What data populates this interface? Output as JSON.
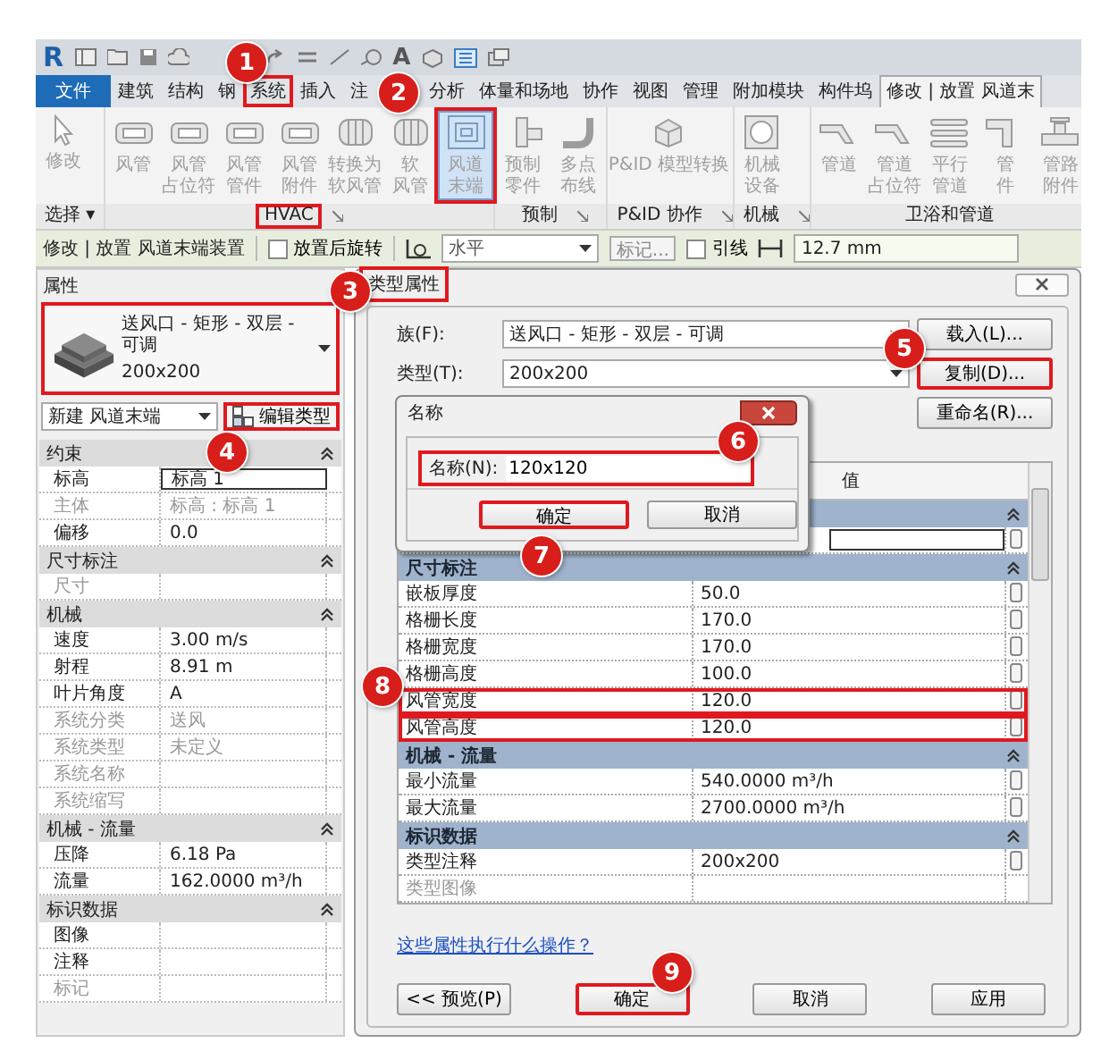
{
  "app_logo": "R",
  "quick_access": {
    "text_tool": "A"
  },
  "ribbon_tabs": [
    {
      "label": "文件",
      "kind": "file",
      "selected": false,
      "highlighted": false
    },
    {
      "label": "建筑",
      "kind": "tab",
      "selected": false,
      "highlighted": false
    },
    {
      "label": "结构",
      "kind": "tab",
      "selected": false,
      "highlighted": false
    },
    {
      "label": "钢",
      "kind": "tab",
      "selected": false,
      "highlighted": false
    },
    {
      "label": "系统",
      "kind": "tab",
      "selected": false,
      "highlighted": true
    },
    {
      "label": "插入",
      "kind": "tab",
      "selected": false,
      "highlighted": false
    },
    {
      "label": "注",
      "kind": "tab",
      "selected": false,
      "highlighted": false
    },
    {
      "label": "分析",
      "kind": "tab",
      "selected": false,
      "highlighted": false
    },
    {
      "label": "体量和场地",
      "kind": "tab",
      "selected": false,
      "highlighted": false
    },
    {
      "label": "协作",
      "kind": "tab",
      "selected": false,
      "highlighted": false
    },
    {
      "label": "视图",
      "kind": "tab",
      "selected": false,
      "highlighted": false
    },
    {
      "label": "管理",
      "kind": "tab",
      "selected": false,
      "highlighted": false
    },
    {
      "label": "附加模块",
      "kind": "tab",
      "selected": false,
      "highlighted": false
    },
    {
      "label": "构件坞",
      "kind": "tab",
      "selected": false,
      "highlighted": false
    },
    {
      "label": "修改 | 放置 风道末",
      "kind": "context",
      "selected": true,
      "highlighted": false
    }
  ],
  "ribbon_panels": [
    {
      "label": "选择 ▾",
      "launcher": false,
      "highlighted": false,
      "buttons": [
        {
          "lines": [
            "修改"
          ],
          "disabled": true,
          "selected": false,
          "highlighted": false
        }
      ]
    },
    {
      "label": "HVAC",
      "launcher": true,
      "highlighted": true,
      "buttons": [
        {
          "lines": [
            "风管"
          ],
          "disabled": true,
          "selected": false,
          "highlighted": false
        },
        {
          "lines": [
            "风管",
            "占位符"
          ],
          "disabled": true,
          "selected": false,
          "highlighted": false
        },
        {
          "lines": [
            "风管",
            "管件"
          ],
          "disabled": true,
          "selected": false,
          "highlighted": false
        },
        {
          "lines": [
            "风管",
            "附件"
          ],
          "disabled": true,
          "selected": false,
          "highlighted": false
        },
        {
          "lines": [
            "转换为",
            "软风管"
          ],
          "disabled": true,
          "selected": false,
          "highlighted": false
        },
        {
          "lines": [
            "软",
            "风管"
          ],
          "disabled": true,
          "selected": false,
          "highlighted": false
        },
        {
          "lines": [
            "风道",
            "末端"
          ],
          "disabled": true,
          "selected": true,
          "highlighted": true
        }
      ]
    },
    {
      "label": "预制",
      "launcher": true,
      "highlighted": false,
      "buttons": [
        {
          "lines": [
            "预制",
            "零件"
          ],
          "disabled": true,
          "selected": false,
          "highlighted": false
        },
        {
          "lines": [
            "多点",
            "布线"
          ],
          "disabled": true,
          "selected": false,
          "highlighted": false
        }
      ]
    },
    {
      "label": "P&ID 协作",
      "launcher": true,
      "highlighted": false,
      "buttons": [
        {
          "lines": [
            "P&ID 模型转换"
          ],
          "disabled": true,
          "selected": false,
          "highlighted": false
        }
      ]
    },
    {
      "label": "机械",
      "launcher": true,
      "highlighted": false,
      "buttons": [
        {
          "lines": [
            "机械",
            "设备"
          ],
          "disabled": true,
          "selected": false,
          "highlighted": false
        }
      ]
    },
    {
      "label": "卫浴和管道",
      "launcher": false,
      "highlighted": false,
      "buttons": [
        {
          "lines": [
            "管道"
          ],
          "disabled": true,
          "selected": false,
          "highlighted": false
        },
        {
          "lines": [
            "管道",
            "占位符"
          ],
          "disabled": true,
          "selected": false,
          "highlighted": false
        },
        {
          "lines": [
            "平行",
            "管道"
          ],
          "disabled": true,
          "selected": false,
          "highlighted": false
        },
        {
          "lines": [
            "管",
            "件"
          ],
          "disabled": true,
          "selected": false,
          "highlighted": false
        },
        {
          "lines": [
            "管路",
            "附件"
          ],
          "disabled": true,
          "selected": false,
          "highlighted": false
        }
      ]
    }
  ],
  "options_bar": {
    "context": "修改 | 放置 风道末端装置",
    "rotate_checkbox": {
      "label": "放置后旋转",
      "checked": false
    },
    "orientation": "水平",
    "tag_button": "标记...",
    "leader_checkbox": {
      "label": "引线",
      "checked": false
    },
    "length": "12.7 mm"
  },
  "properties_panel": {
    "title": "属性",
    "type_name": "送风口 - 矩形 - 双层 - 可调",
    "type_size": "200x200",
    "highlighted": true,
    "instance_filter": "新建 风道末端",
    "edit_type_button": {
      "label": "编辑类型",
      "highlighted": true
    },
    "groups": [
      {
        "name": "约束",
        "rows": [
          {
            "name": "标高",
            "value": "标高 1",
            "kind": "field",
            "disabled": false
          },
          {
            "name": "主体",
            "value": "标高 : 标高 1",
            "kind": "text",
            "disabled": true
          },
          {
            "name": "偏移",
            "value": "0.0",
            "kind": "text",
            "disabled": false
          }
        ]
      },
      {
        "name": "尺寸标注",
        "rows": [
          {
            "name": "尺寸",
            "kind": "text",
            "disabled": true
          }
        ]
      },
      {
        "name": "机械",
        "rows": [
          {
            "name": "速度",
            "value": "3.00 m/s",
            "kind": "text",
            "disabled": false
          },
          {
            "name": "射程",
            "value": "8.91 m",
            "kind": "text",
            "disabled": false
          },
          {
            "name": "叶片角度",
            "value": "A",
            "kind": "text",
            "disabled": false
          },
          {
            "name": "系统分类",
            "value": "送风",
            "kind": "text",
            "disabled": true
          },
          {
            "name": "系统类型",
            "value": "未定义",
            "kind": "text",
            "disabled": true
          },
          {
            "name": "系统名称",
            "kind": "text",
            "disabled": true
          },
          {
            "name": "系统缩写",
            "kind": "text",
            "disabled": true
          }
        ]
      },
      {
        "name": "机械 - 流量",
        "rows": [
          {
            "name": "压降",
            "value": "6.18 Pa",
            "kind": "text",
            "disabled": false
          },
          {
            "name": "流量",
            "value": "162.0000 m³/h",
            "kind": "text",
            "disabled": false
          }
        ]
      },
      {
        "name": "标识数据",
        "rows": [
          {
            "name": "图像",
            "kind": "text",
            "disabled": false
          },
          {
            "name": "注释",
            "kind": "text",
            "disabled": false
          },
          {
            "name": "标记",
            "kind": "text",
            "disabled": true
          }
        ]
      }
    ]
  },
  "type_dialog": {
    "title": "类型属性",
    "title_highlighted": true,
    "family_label": "族(F):",
    "family": "送风口 - 矩形 - 双层 - 可调",
    "load_button": "载入(L)...",
    "type_label": "类型(T):",
    "type": "200x200",
    "duplicate_button": {
      "label": "复制(D)...",
      "highlighted": true
    },
    "rename_button": "重命名(R)...",
    "value_header": "值",
    "groups": [
      {
        "rows": [
          {
            "kind": "field",
            "disabled": false,
            "highlighted": false
          }
        ]
      },
      {
        "name": "尺寸标注",
        "rows": [
          {
            "name": "嵌板厚度",
            "value": "50.0",
            "kind": "text",
            "disabled": false,
            "highlighted": false
          },
          {
            "name": "格栅长度",
            "value": "170.0",
            "kind": "text",
            "disabled": false,
            "highlighted": false
          },
          {
            "name": "格栅宽度",
            "value": "170.0",
            "kind": "text",
            "disabled": false,
            "highlighted": false
          },
          {
            "name": "格栅高度",
            "value": "100.0",
            "kind": "text",
            "disabled": false,
            "highlighted": false
          },
          {
            "name": "风管宽度",
            "value": "120.0",
            "kind": "text",
            "disabled": false,
            "highlighted": true
          },
          {
            "name": "风管高度",
            "value": "120.0",
            "kind": "text",
            "disabled": false,
            "highlighted": true
          }
        ]
      },
      {
        "name": "机械 - 流量",
        "rows": [
          {
            "name": "最小流量",
            "value": "540.0000 m³/h",
            "kind": "text",
            "disabled": false,
            "highlighted": false
          },
          {
            "name": "最大流量",
            "value": "2700.0000 m³/h",
            "kind": "text",
            "disabled": false,
            "highlighted": false
          }
        ]
      },
      {
        "name": "标识数据",
        "rows": [
          {
            "name": "类型注释",
            "value": "200x200",
            "kind": "text",
            "disabled": false,
            "highlighted": false
          },
          {
            "name": "类型图像",
            "kind": "text",
            "disabled": true,
            "highlighted": false
          }
        ]
      }
    ],
    "help_link": "这些属性执行什么操作？",
    "buttons": [
      {
        "label": "<< 预览(P)",
        "highlighted": false
      },
      {
        "label": "确定",
        "highlighted": true
      },
      {
        "label": "取消",
        "highlighted": false
      },
      {
        "label": "应用",
        "highlighted": false
      }
    ]
  },
  "name_dialog": {
    "title": "名称",
    "field_label": "名称(N):",
    "value": "120x120",
    "field_highlighted": true,
    "buttons": [
      {
        "label": "确定",
        "highlighted": true
      },
      {
        "label": "取消",
        "highlighted": false
      }
    ]
  },
  "step_markers": [
    "1",
    "2",
    "3",
    "4",
    "5",
    "6",
    "7",
    "8",
    "9"
  ]
}
